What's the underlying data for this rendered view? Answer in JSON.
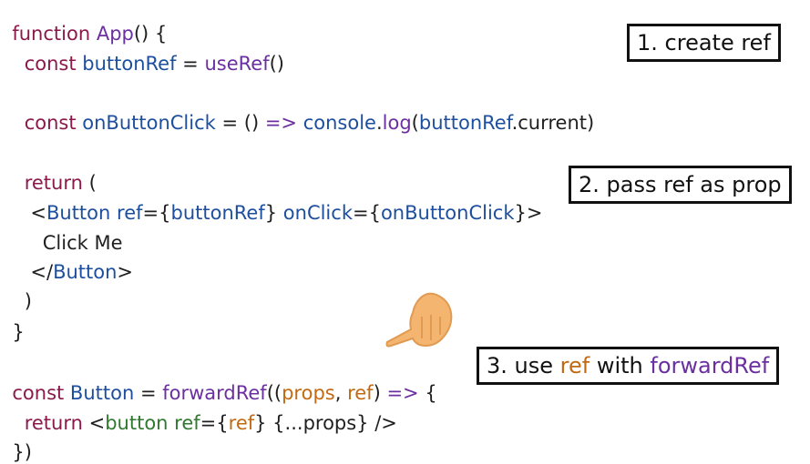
{
  "code": {
    "l1": {
      "kw": "function ",
      "name": "App",
      "rest": "() {"
    },
    "l2": {
      "kw": "  const ",
      "ident": "buttonRef",
      "eq": " = ",
      "fn": "useRef",
      "rest": "()"
    },
    "l3": {
      "kw": "  const ",
      "ident": "onButtonClick",
      "eq": " = () ",
      "arrow": "=>",
      "sp": " ",
      "obj": "console",
      "dot": ".",
      "fn": "log",
      "p1": "(",
      "arg": "buttonRef",
      "dot2": ".",
      "prop": "current",
      "p2": ")"
    },
    "l4": {
      "kw": "  return",
      "rest": " ("
    },
    "l5": {
      "open": "   <",
      "comp": "Button",
      "sp": " ",
      "attr1": "ref",
      "eq1": "={",
      "val1": "buttonRef",
      "close1": "}",
      "sp2": " ",
      "attr2": "onClick",
      "eq2": "={",
      "val2": "onButtonClick",
      "close2": "}",
      "end": ">"
    },
    "l6": {
      "text": "     Click Me"
    },
    "l7": {
      "open": "   </",
      "comp": "Button",
      "end": ">"
    },
    "l8": {
      "text": "  )"
    },
    "l9": {
      "text": "}"
    },
    "l10": {
      "kw": "const ",
      "ident": "Button",
      "eq": " = ",
      "fn": "forwardRef",
      "p1": "((",
      "a1": "props",
      "comma": ", ",
      "a2": "ref",
      "p2": ") ",
      "arrow": "=>",
      "rest": " {"
    },
    "l11": {
      "kw": "  return ",
      "open": "<",
      "tag": "button",
      "sp": " ",
      "attr": "ref",
      "eq": "={",
      "val": "ref",
      "close": "} {...props} />"
    },
    "l12": {
      "text": "})"
    }
  },
  "callouts": {
    "c1": "1. create ref",
    "c2": "2. pass ref as prop",
    "c3": {
      "pre": "3. use ",
      "ref": "ref",
      "mid": " with ",
      "fr": "forwardRef"
    }
  }
}
